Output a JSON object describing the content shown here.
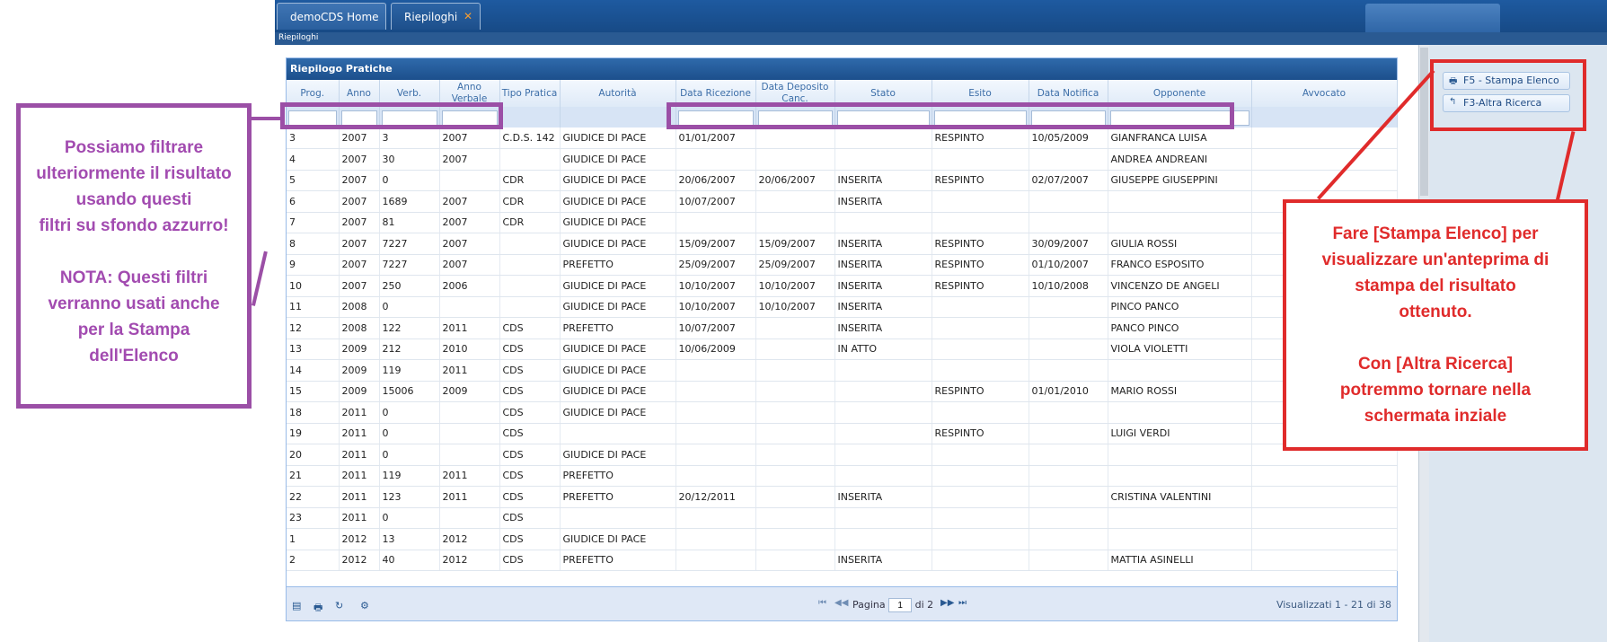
{
  "tabs": [
    {
      "label": "demoCDS Home"
    },
    {
      "label": "Riepiloghi",
      "close": "✕"
    }
  ],
  "breadcrumb": "Riepiloghi",
  "panel_title": "Riepilogo Pratiche",
  "right_buttons": [
    {
      "label": "F5 - Stampa Elenco",
      "icon": "printer-icon"
    },
    {
      "label": "F3-Altra Ricerca",
      "icon": "back-arrow-icon"
    }
  ],
  "columns": [
    "Prog.",
    "Anno",
    "Verb.",
    "Anno Verbale",
    "Tipo Pratica",
    "Autorità",
    "Data Ricezione",
    "Data Deposito Canc.",
    "Stato",
    "Esito",
    "Data Notifica",
    "Opponente",
    "Avvocato"
  ],
  "rows": [
    [
      "3",
      "2007",
      "3",
      "2007",
      "C.D.S. 142",
      "GIUDICE DI PACE",
      "01/01/2007",
      "",
      "",
      "RESPINTO",
      "10/05/2009",
      "GIANFRANCA LUISA",
      ""
    ],
    [
      "4",
      "2007",
      "30",
      "2007",
      "",
      "GIUDICE DI PACE",
      "",
      "",
      "",
      "",
      "",
      "ANDREA ANDREANI",
      ""
    ],
    [
      "5",
      "2007",
      "0",
      "",
      "CDR",
      "GIUDICE DI PACE",
      "20/06/2007",
      "20/06/2007",
      "INSERITA",
      "RESPINTO",
      "02/07/2007",
      "GIUSEPPE GIUSEPPINI",
      ""
    ],
    [
      "6",
      "2007",
      "1689",
      "2007",
      "CDR",
      "GIUDICE DI PACE",
      "10/07/2007",
      "",
      "INSERITA",
      "",
      "",
      "",
      ""
    ],
    [
      "7",
      "2007",
      "81",
      "2007",
      "CDR",
      "GIUDICE DI PACE",
      "",
      "",
      "",
      "",
      "",
      "",
      ""
    ],
    [
      "8",
      "2007",
      "7227",
      "2007",
      "",
      "GIUDICE DI PACE",
      "15/09/2007",
      "15/09/2007",
      "INSERITA",
      "RESPINTO",
      "30/09/2007",
      "GIULIA ROSSI",
      ""
    ],
    [
      "9",
      "2007",
      "7227",
      "2007",
      "",
      "PREFETTO",
      "25/09/2007",
      "25/09/2007",
      "INSERITA",
      "RESPINTO",
      "01/10/2007",
      "FRANCO ESPOSITO",
      ""
    ],
    [
      "10",
      "2007",
      "250",
      "2006",
      "",
      "GIUDICE DI PACE",
      "10/10/2007",
      "10/10/2007",
      "INSERITA",
      "RESPINTO",
      "10/10/2008",
      "VINCENZO DE ANGELI",
      ""
    ],
    [
      "11",
      "2008",
      "0",
      "",
      "",
      "GIUDICE DI PACE",
      "10/10/2007",
      "10/10/2007",
      "INSERITA",
      "",
      "",
      "PINCO PANCO",
      ""
    ],
    [
      "12",
      "2008",
      "122",
      "2011",
      "CDS",
      "PREFETTO",
      "10/07/2007",
      "",
      "INSERITA",
      "",
      "",
      "PANCO PINCO",
      ""
    ],
    [
      "13",
      "2009",
      "212",
      "2010",
      "CDS",
      "GIUDICE DI PACE",
      "10/06/2009",
      "",
      "IN ATTO",
      "",
      "",
      "VIOLA VIOLETTI",
      ""
    ],
    [
      "14",
      "2009",
      "119",
      "2011",
      "CDS",
      "GIUDICE DI PACE",
      "",
      "",
      "",
      "",
      "",
      "",
      ""
    ],
    [
      "15",
      "2009",
      "15006",
      "2009",
      "CDS",
      "GIUDICE DI PACE",
      "",
      "",
      "",
      "RESPINTO",
      "01/01/2010",
      "MARIO ROSSI",
      ""
    ],
    [
      "18",
      "2011",
      "0",
      "",
      "CDS",
      "GIUDICE DI PACE",
      "",
      "",
      "",
      "",
      "",
      "",
      ""
    ],
    [
      "19",
      "2011",
      "0",
      "",
      "CDS",
      "",
      "",
      "",
      "",
      "RESPINTO",
      "",
      "LUIGI VERDI",
      ""
    ],
    [
      "20",
      "2011",
      "0",
      "",
      "CDS",
      "GIUDICE DI PACE",
      "",
      "",
      "",
      "",
      "",
      "",
      ""
    ],
    [
      "21",
      "2011",
      "119",
      "2011",
      "CDS",
      "PREFETTO",
      "",
      "",
      "",
      "",
      "",
      "",
      ""
    ],
    [
      "22",
      "2011",
      "123",
      "2011",
      "CDS",
      "PREFETTO",
      "20/12/2011",
      "",
      "INSERITA",
      "",
      "",
      "CRISTINA VALENTINI",
      ""
    ],
    [
      "23",
      "2011",
      "0",
      "",
      "CDS",
      "",
      "",
      "",
      "",
      "",
      "",
      "",
      ""
    ],
    [
      "1",
      "2012",
      "13",
      "2012",
      "CDS",
      "GIUDICE DI PACE",
      "",
      "",
      "",
      "",
      "",
      "",
      ""
    ],
    [
      "2",
      "2012",
      "40",
      "2012",
      "CDS",
      "PREFETTO",
      "",
      "",
      "INSERITA",
      "",
      "",
      "MATTIA ASINELLI",
      ""
    ]
  ],
  "pager": {
    "page_label": "Pagina",
    "page": "1",
    "of_label": "di 2",
    "info": "Visualizzati 1 - 21 di 38"
  },
  "note_left": [
    "Possiamo filtrare",
    "ulteriormente il risultato",
    "usando questi",
    "filtri su sfondo azzurro!",
    "",
    "NOTA: Questi filtri",
    "verranno usati anche",
    "per la Stampa",
    "dell'Elenco"
  ],
  "note_right": [
    "Fare [Stampa Elenco] per",
    "visualizzare un'anteprima di",
    "stampa del risultato",
    "ottenuto.",
    "",
    "Con [Altra Ricerca]",
    "potremmo tornare nella",
    "schermata inziale"
  ],
  "colors": {
    "purple": "#9b4fa6",
    "red": "#e02b2b",
    "accent": "#1c4f8c"
  }
}
